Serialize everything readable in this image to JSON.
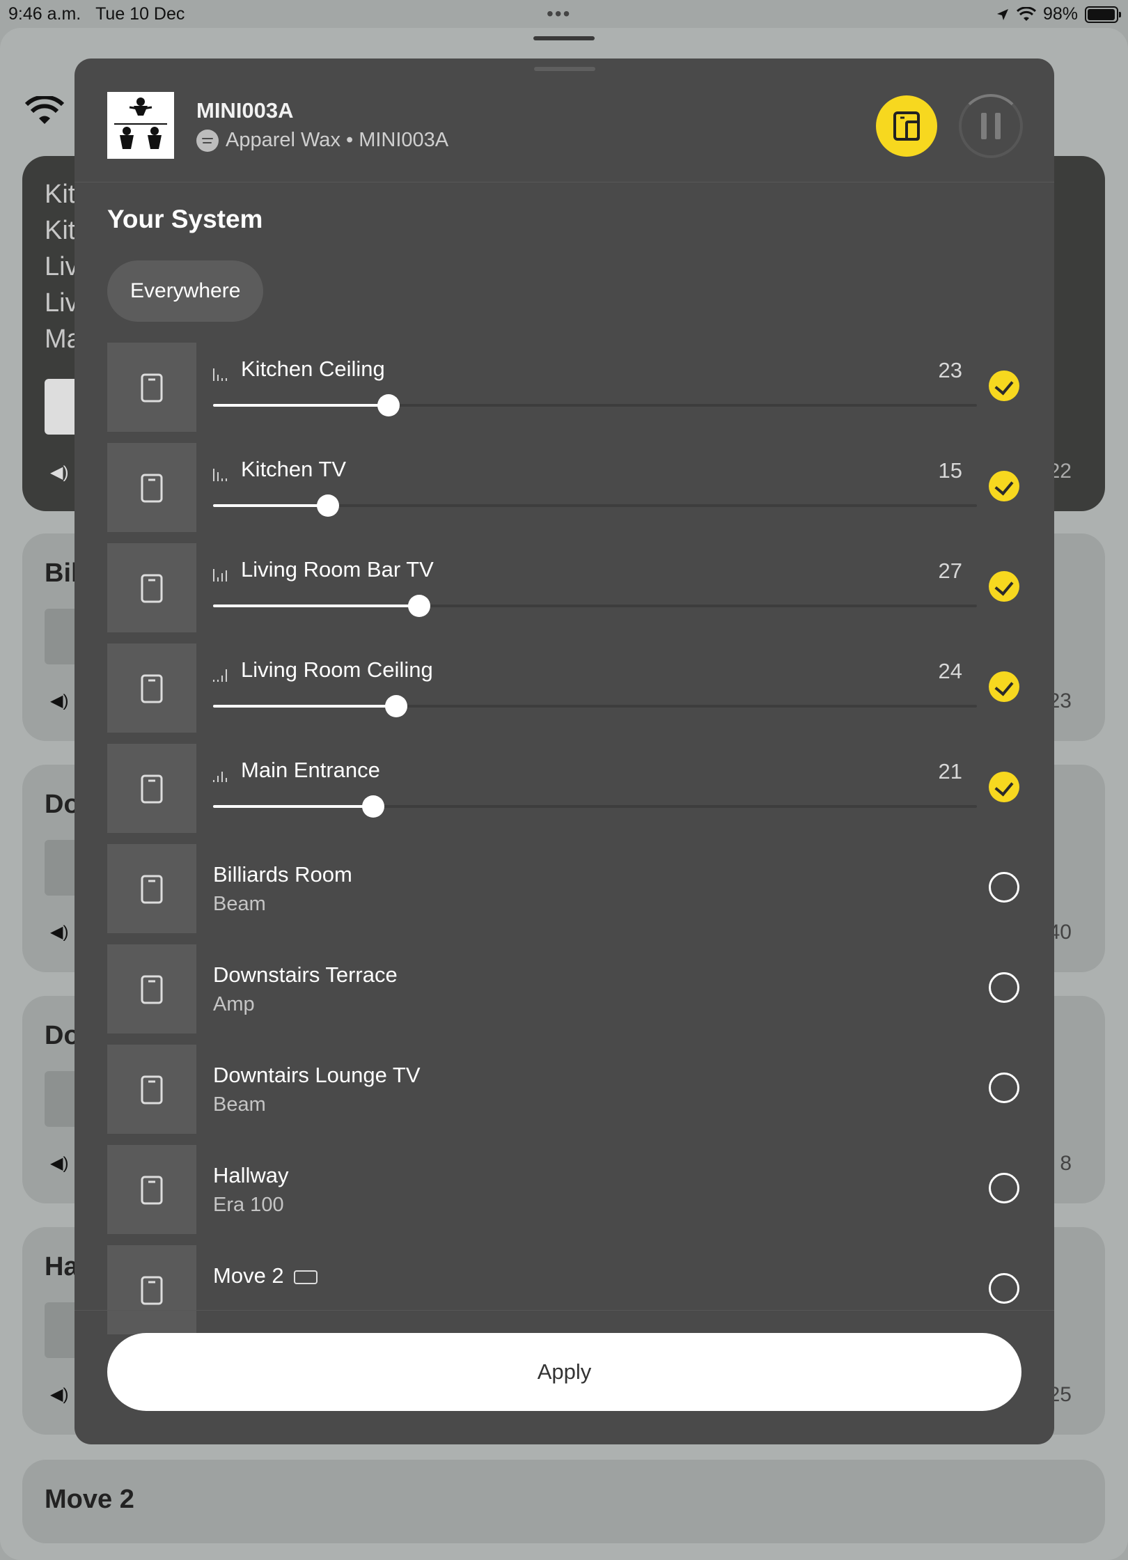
{
  "status_bar": {
    "time": "9:46 a.m.",
    "date": "Tue 10 Dec",
    "battery": "98%",
    "battery_level": 0.98
  },
  "background_cards": [
    {
      "titles": [
        "Kit",
        "Kit",
        "Liv",
        "Liv",
        "Ma"
      ],
      "volume": "22"
    },
    {
      "title": "Bil",
      "volume": "23"
    },
    {
      "title": "Do",
      "volume": "40"
    },
    {
      "title": "Do",
      "volume": "8"
    },
    {
      "title": "Ha",
      "volume": "25"
    },
    {
      "title": "Move 2"
    }
  ],
  "now_playing": {
    "title": "MINI003A",
    "subtitle": "Apparel Wax • MINI003A",
    "source_icon": "spotify-icon"
  },
  "section_title": "Your System",
  "everywhere_label": "Everywhere",
  "rooms": [
    {
      "name": "Kitchen Ceiling",
      "volume": "23",
      "level": 0.23,
      "selected": true
    },
    {
      "name": "Kitchen TV",
      "volume": "15",
      "level": 0.15,
      "selected": true
    },
    {
      "name": "Living Room Bar TV",
      "volume": "27",
      "level": 0.27,
      "selected": true
    },
    {
      "name": "Living Room Ceiling",
      "volume": "24",
      "level": 0.24,
      "selected": true
    },
    {
      "name": "Main Entrance",
      "volume": "21",
      "level": 0.21,
      "selected": true
    },
    {
      "name": "Billiards Room",
      "device": "Beam",
      "selected": false
    },
    {
      "name": "Downstairs Terrace",
      "device": "Amp",
      "selected": false
    },
    {
      "name": "Downtairs Lounge TV",
      "device": "Beam",
      "selected": false
    },
    {
      "name": "Hallway",
      "device": "Era 100",
      "selected": false
    },
    {
      "name": "Move 2",
      "selected": false
    }
  ],
  "apply_label": "Apply",
  "colors": {
    "accent": "#f7d81f",
    "modal": "#4a4a4a"
  }
}
